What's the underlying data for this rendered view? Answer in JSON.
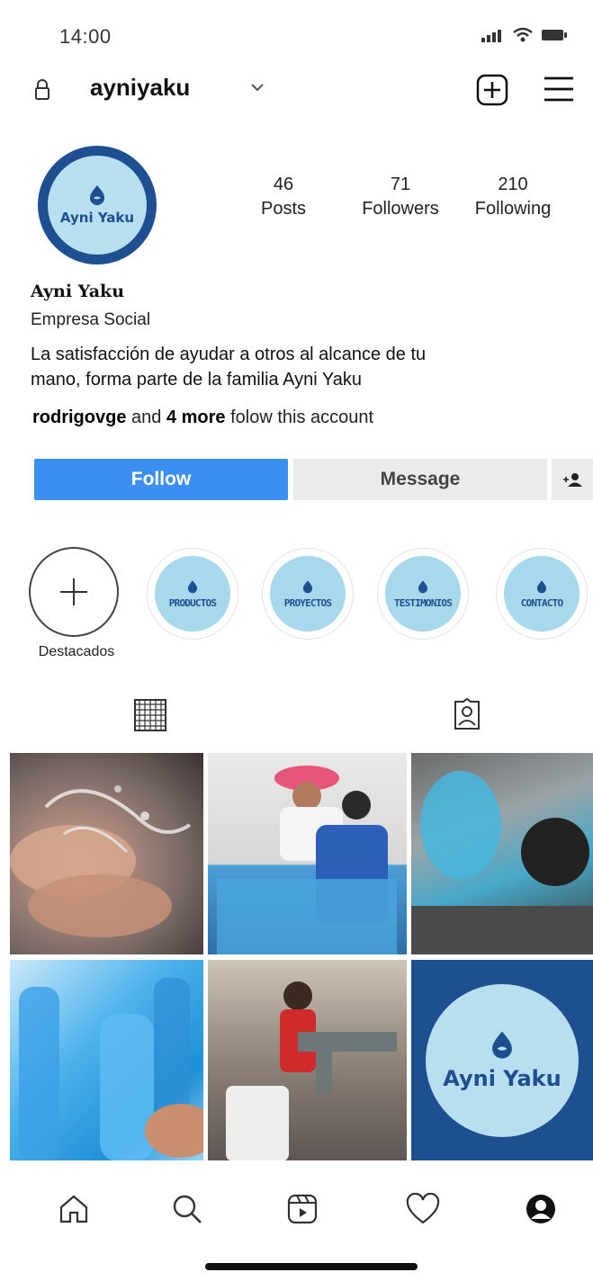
{
  "status_bar": {
    "time": "14:00",
    "icons": [
      "signal-icon",
      "wifi-icon",
      "battery-icon"
    ]
  },
  "header": {
    "username": "ayniyaku",
    "icons": [
      "lock-icon",
      "chevron-down-icon",
      "add-post-icon",
      "menu-icon"
    ]
  },
  "profile": {
    "avatar_text": "Ayni Yaku",
    "stats": [
      {
        "value": "46",
        "label": "Posts"
      },
      {
        "value": "71",
        "label": "Followers"
      },
      {
        "value": "210",
        "label": "Following"
      }
    ],
    "display_name": "Ayni Yaku",
    "category": "Empresa Social",
    "bio_line1": "La satisfacción de ayudar a otros al alcance de tu",
    "bio_line2": "mano, forma parte de la familia Ayni Yaku",
    "followed_by": {
      "user": "rodrigovge",
      "and": " and ",
      "more": "4 more",
      "suffix": " folow this account"
    }
  },
  "actions": {
    "follow": "Follow",
    "message": "Message"
  },
  "highlights": {
    "new_label": "Destacados",
    "items": [
      {
        "label": "PRODUCTOS"
      },
      {
        "label": "PROYECTOS"
      },
      {
        "label": "TESTIMONIOS"
      },
      {
        "label": "CONTACTO"
      }
    ]
  },
  "tabs": [
    "grid-icon",
    "tagged-icon"
  ],
  "posts": {
    "last_tile_text": "Ayni Yaku"
  },
  "bottom_nav": [
    "home-icon",
    "search-icon",
    "reels-icon",
    "heart-icon",
    "profile-icon"
  ],
  "colors": {
    "brand_dark": "#1d4f91",
    "brand_light": "#b8dff0",
    "follow_button": "#3b8ff0"
  }
}
